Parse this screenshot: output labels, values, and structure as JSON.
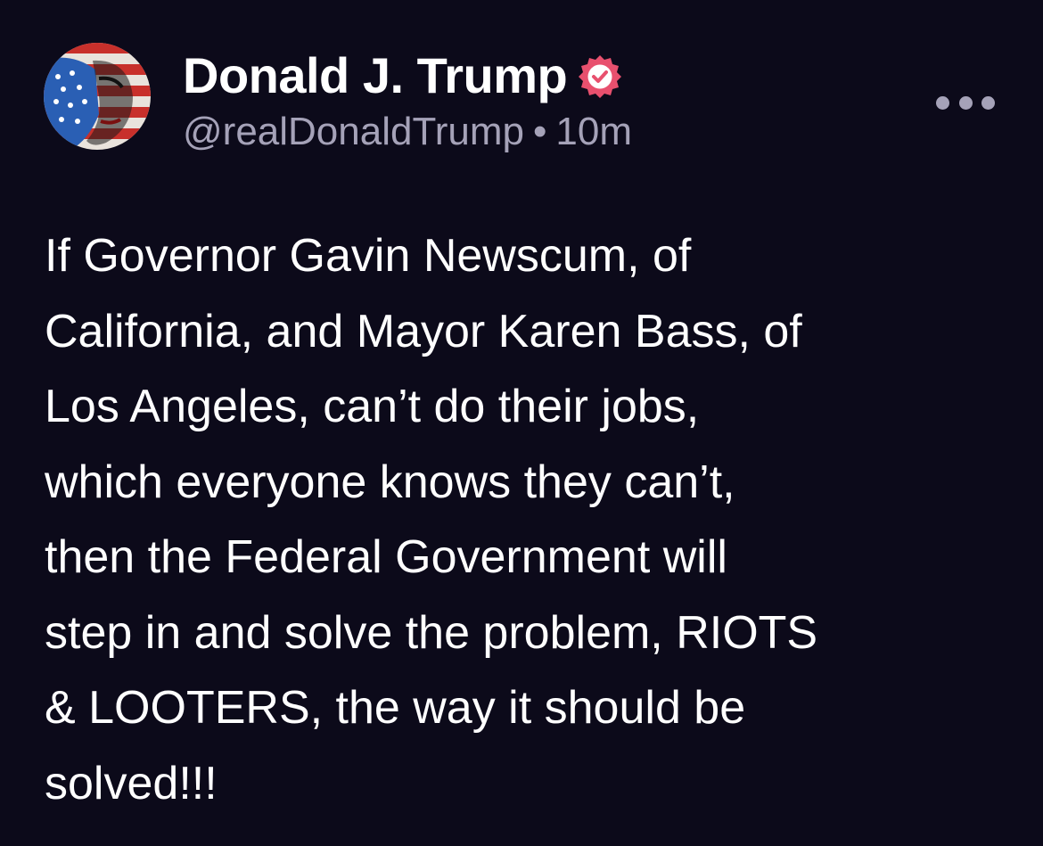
{
  "post": {
    "author": {
      "display_name": "Donald J. Trump",
      "handle": "@realDonaldTrump",
      "verified": true,
      "avatar": "flag-portrait-avatar"
    },
    "separator": "•",
    "timestamp": "10m",
    "more_icon": "ellipsis-icon",
    "body_lines": [
      "If Governor Gavin Newscum, of",
      "California, and Mayor Karen Bass, of",
      "Los Angeles, can’t do their jobs,",
      "which everyone knows they can’t,",
      "then the Federal Government will",
      "step in and solve the problem, RIOTS",
      "& LOOTERS, the way it should be",
      "solved!!!"
    ]
  },
  "colors": {
    "background": "#0c0a1a",
    "text": "#ffffff",
    "muted": "#a5a2b8",
    "verified_badge": "#e8506e"
  }
}
